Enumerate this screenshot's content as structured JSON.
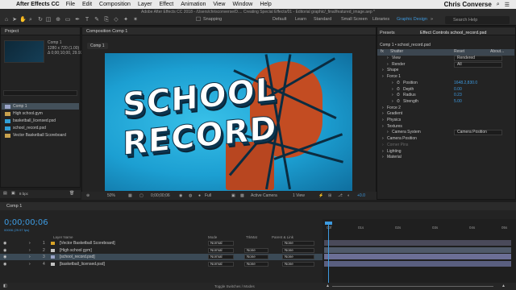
{
  "menubar": {
    "app_name": "After Effects CC",
    "items": [
      "File",
      "Edit",
      "Composition",
      "Layer",
      "Effect",
      "Animation",
      "View",
      "Window",
      "Help"
    ],
    "user": "Chris Converse"
  },
  "window": {
    "title": "Adobe After Effects CC 2018 - /Users/chrisconverse/D.... Creating Special Effects/01 - Editorial graphic/_final/featured_image.aep *"
  },
  "toolbar": {
    "snapping_label": "Snapping",
    "workspaces": [
      "Default",
      "Learn",
      "Standard",
      "Small Screen",
      "Libraries",
      "Graphic Design"
    ],
    "active_workspace": "Graphic Design",
    "search_placeholder": "Search Help"
  },
  "project": {
    "tab_label": "Project",
    "selected_name": "Comp 1",
    "selected_info_1": "1280 x 720 (1.00)",
    "selected_info_2": "Δ 0;00;10;00, 29.97 fps",
    "items": [
      {
        "name": "Comp 1",
        "kind": "comp"
      },
      {
        "name": "High school.gym",
        "kind": "folder"
      },
      {
        "name": "basketball_licensed.psd",
        "kind": "file"
      },
      {
        "name": "school_record.psd",
        "kind": "file"
      },
      {
        "name": "Vector Basketball Scoreboard",
        "kind": "folder"
      }
    ],
    "bpc": "8 bpc"
  },
  "composition": {
    "tab_label": "Composition Comp 1",
    "crumb": "Comp 1",
    "headline_line1": "SCHOOL",
    "headline_line2": "RECORD",
    "zoom": "50%",
    "timecode": "0;00;00;06",
    "resolution": "Full",
    "camera": "Active Camera",
    "views": "1 View",
    "exposure": "+0.0"
  },
  "effects": {
    "tab_presets": "Presets",
    "tab_controls": "Effect Controls school_record.psd",
    "subject": "Comp 1 • school_record.psd",
    "effect_name": "Shatter",
    "reset": "Reset",
    "about": "About...",
    "rows": [
      {
        "label": "View",
        "value": "Rendered",
        "type": "dropdown",
        "indent": 1
      },
      {
        "label": "Render",
        "value": "All",
        "type": "dropdown",
        "indent": 1
      },
      {
        "label": "Shape",
        "value": "",
        "type": "group",
        "indent": 0
      },
      {
        "label": "Force 1",
        "value": "",
        "type": "group",
        "indent": 0
      },
      {
        "label": "Position",
        "value": "1648.2,830.0",
        "type": "value",
        "indent": 2
      },
      {
        "label": "Depth",
        "value": "0.00",
        "type": "value",
        "indent": 2
      },
      {
        "label": "Radius",
        "value": "0.23",
        "type": "value",
        "indent": 2
      },
      {
        "label": "Strength",
        "value": "5.00",
        "type": "value",
        "indent": 2
      },
      {
        "label": "Force 2",
        "value": "",
        "type": "group",
        "indent": 0
      },
      {
        "label": "Gradient",
        "value": "",
        "type": "group",
        "indent": 0
      },
      {
        "label": "Physics",
        "value": "",
        "type": "group",
        "indent": 0
      },
      {
        "label": "Textures",
        "value": "",
        "type": "group",
        "indent": 0
      },
      {
        "label": "Camera System",
        "value": "Camera Position",
        "type": "dropdown",
        "indent": 1
      },
      {
        "label": "Camera Position",
        "value": "",
        "type": "group",
        "indent": 0
      },
      {
        "label": "Corner Pins",
        "value": "",
        "type": "group-dim",
        "indent": 0
      },
      {
        "label": "Lighting",
        "value": "",
        "type": "group",
        "indent": 0
      },
      {
        "label": "Material",
        "value": "",
        "type": "group",
        "indent": 0
      }
    ]
  },
  "timeline": {
    "tab_label": "Comp 1",
    "timecode": "0;00;00;06",
    "frames": "00006 (29.97 fps)",
    "headers": {
      "layer_name": "Layer Name",
      "mode": "Mode",
      "trkmat": "TrkMat",
      "parent": "Parent & Link"
    },
    "ruler": [
      "00f",
      "01s",
      "02s",
      "03s",
      "04s",
      "05s"
    ],
    "layers": [
      {
        "num": "1",
        "name": "[Vector Basketball Scoreboard]",
        "mode": "Normal",
        "trkmat": "",
        "parent": "None",
        "tag": "#d9a326"
      },
      {
        "num": "2",
        "name": "[High school gym]",
        "mode": "Normal",
        "trkmat": "None",
        "parent": "None",
        "tag": "#c3c3c3"
      },
      {
        "num": "3",
        "name": "[school_record.psd]",
        "mode": "Normal",
        "trkmat": "None",
        "parent": "None",
        "tag": "#9aa4c8"
      },
      {
        "num": "4",
        "name": "[basketball_licensed.psd]",
        "mode": "Normal",
        "trkmat": "None",
        "parent": "None",
        "tag": "#c3c3c3"
      }
    ],
    "toggle_label": "Toggle Switches / Modes"
  },
  "colors": {
    "accent": "#3d9ae0",
    "panel": "#232323",
    "canvas_blue": "#1c9fd2"
  }
}
